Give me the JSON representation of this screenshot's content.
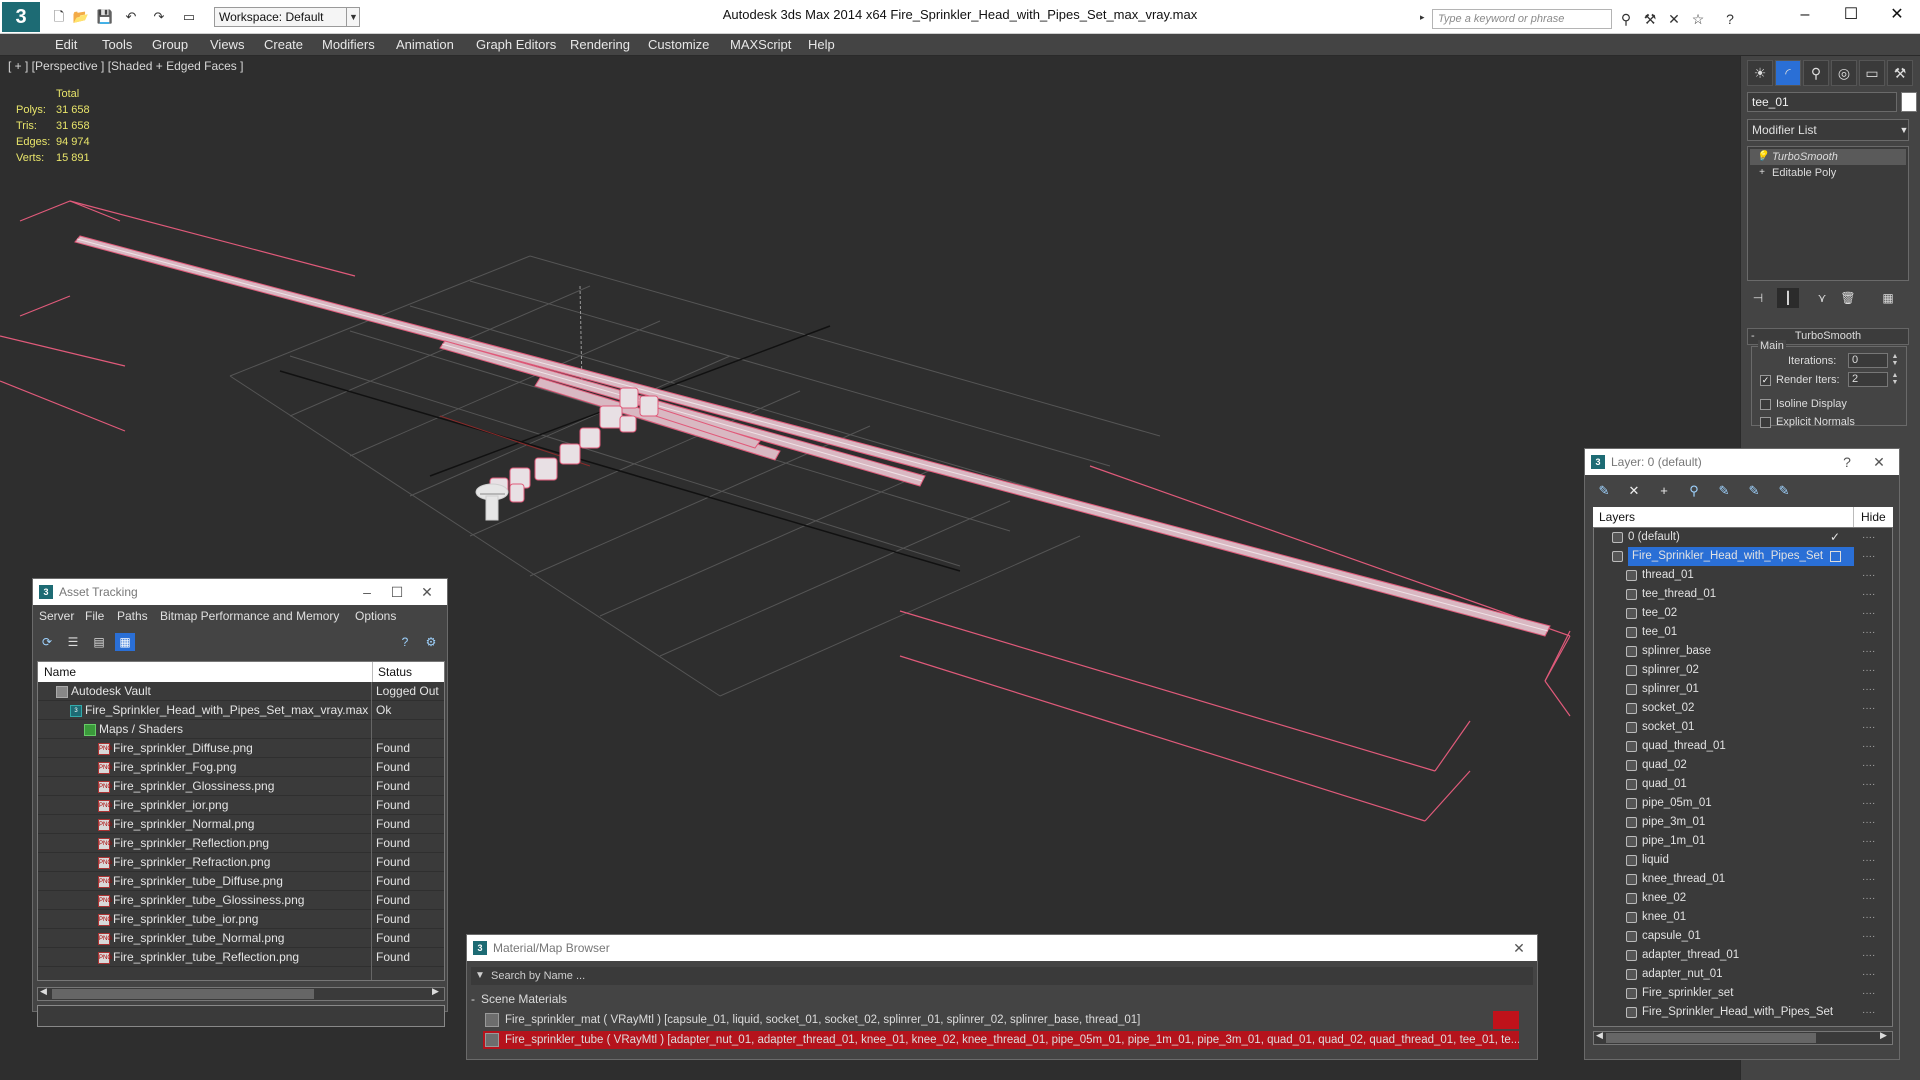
{
  "window": {
    "app_title": "Autodesk 3ds Max  2014 x64        Fire_Sprinkler_Head_with_Pipes_Set_max_vray.max",
    "workspace": "Workspace: Default",
    "search_placeholder": "Type a keyword or phrase",
    "minimize": "–",
    "maximize": "☐",
    "close": "✕"
  },
  "menu": [
    "Edit",
    "Tools",
    "Group",
    "Views",
    "Create",
    "Modifiers",
    "Animation",
    "Graph Editors",
    "Rendering",
    "Customize",
    "MAXScript",
    "Help"
  ],
  "viewport": {
    "label": "[ + ] [Perspective ] [Shaded + Edged Faces ]",
    "stats_header": "Total",
    "stats": [
      {
        "label": "Polys:",
        "value": "31 658"
      },
      {
        "label": "Tris:",
        "value": "31 658"
      },
      {
        "label": "Edges:",
        "value": "94 974"
      },
      {
        "label": "Verts:",
        "value": "15 891"
      }
    ]
  },
  "command_panel": {
    "object_name": "tee_01",
    "modifier_list": "Modifier List",
    "stack": [
      {
        "label": "TurboSmooth",
        "italic": true
      },
      {
        "label": "Editable Poly",
        "italic": false
      }
    ],
    "rollout_title": "TurboSmooth",
    "group_main": "Main",
    "iterations_label": "Iterations:",
    "iterations_value": "0",
    "render_iters_label": "Render Iters:",
    "render_iters_value": "2",
    "isoline_label": "Isoline Display",
    "explicit_label": "Explicit Normals"
  },
  "asset_tracking": {
    "title": "Asset Tracking",
    "menu": [
      "Server",
      "File",
      "Paths",
      "Bitmap Performance and Memory",
      "Options"
    ],
    "col_name": "Name",
    "col_status": "Status",
    "rows": [
      {
        "name": "Autodesk Vault",
        "status": "Logged Out",
        "indent": 1,
        "icon": "vault"
      },
      {
        "name": "Fire_Sprinkler_Head_with_Pipes_Set_max_vray.max",
        "status": "Ok",
        "indent": 2,
        "icon": "max"
      },
      {
        "name": "Maps / Shaders",
        "status": "",
        "indent": 3,
        "icon": "maps"
      },
      {
        "name": "Fire_sprinkler_Diffuse.png",
        "status": "Found",
        "indent": 4,
        "icon": "png"
      },
      {
        "name": "Fire_sprinkler_Fog.png",
        "status": "Found",
        "indent": 4,
        "icon": "png"
      },
      {
        "name": "Fire_sprinkler_Glossiness.png",
        "status": "Found",
        "indent": 4,
        "icon": "png"
      },
      {
        "name": "Fire_sprinkler_ior.png",
        "status": "Found",
        "indent": 4,
        "icon": "png"
      },
      {
        "name": "Fire_sprinkler_Normal.png",
        "status": "Found",
        "indent": 4,
        "icon": "png"
      },
      {
        "name": "Fire_sprinkler_Reflection.png",
        "status": "Found",
        "indent": 4,
        "icon": "png"
      },
      {
        "name": "Fire_sprinkler_Refraction.png",
        "status": "Found",
        "indent": 4,
        "icon": "png"
      },
      {
        "name": "Fire_sprinkler_tube_Diffuse.png",
        "status": "Found",
        "indent": 4,
        "icon": "png"
      },
      {
        "name": "Fire_sprinkler_tube_Glossiness.png",
        "status": "Found",
        "indent": 4,
        "icon": "png"
      },
      {
        "name": "Fire_sprinkler_tube_ior.png",
        "status": "Found",
        "indent": 4,
        "icon": "png"
      },
      {
        "name": "Fire_sprinkler_tube_Normal.png",
        "status": "Found",
        "indent": 4,
        "icon": "png"
      },
      {
        "name": "Fire_sprinkler_tube_Reflection.png",
        "status": "Found",
        "indent": 4,
        "icon": "png"
      }
    ]
  },
  "material_browser": {
    "title": "Material/Map Browser",
    "search_placeholder": "Search by Name ...",
    "section": "Scene Materials",
    "materials": [
      "Fire_sprinkler_mat  ( VRayMtl ) [capsule_01, liquid, socket_01, socket_02, splinrer_01, splinrer_02, splinrer_base, thread_01]",
      "Fire_sprinkler_tube  ( VRayMtl ) [adapter_nut_01, adapter_thread_01, knee_01, knee_02, knee_thread_01, pipe_05m_01, pipe_1m_01, pipe_3m_01, quad_01, quad_02, quad_thread_01, tee_01, te..."
    ]
  },
  "layers": {
    "title": "Layer: 0 (default)",
    "help": "?",
    "col_layers": "Layers",
    "col_hide": "Hide",
    "rows": [
      {
        "name": "0 (default)",
        "type": "layer",
        "selected": false
      },
      {
        "name": "Fire_Sprinkler_Head_with_Pipes_Set",
        "type": "layer",
        "selected": true
      },
      {
        "name": "thread_01",
        "type": "object",
        "selected": false
      },
      {
        "name": "tee_thread_01",
        "type": "object",
        "selected": false
      },
      {
        "name": "tee_02",
        "type": "object",
        "selected": false
      },
      {
        "name": "tee_01",
        "type": "object",
        "selected": false
      },
      {
        "name": "splinrer_base",
        "type": "object",
        "selected": false
      },
      {
        "name": "splinrer_02",
        "type": "object",
        "selected": false
      },
      {
        "name": "splinrer_01",
        "type": "object",
        "selected": false
      },
      {
        "name": "socket_02",
        "type": "object",
        "selected": false
      },
      {
        "name": "socket_01",
        "type": "object",
        "selected": false
      },
      {
        "name": "quad_thread_01",
        "type": "object",
        "selected": false
      },
      {
        "name": "quad_02",
        "type": "object",
        "selected": false
      },
      {
        "name": "quad_01",
        "type": "object",
        "selected": false
      },
      {
        "name": "pipe_05m_01",
        "type": "object",
        "selected": false
      },
      {
        "name": "pipe_3m_01",
        "type": "object",
        "selected": false
      },
      {
        "name": "pipe_1m_01",
        "type": "object",
        "selected": false
      },
      {
        "name": "liquid",
        "type": "object",
        "selected": false
      },
      {
        "name": "knee_thread_01",
        "type": "object",
        "selected": false
      },
      {
        "name": "knee_02",
        "type": "object",
        "selected": false
      },
      {
        "name": "knee_01",
        "type": "object",
        "selected": false
      },
      {
        "name": "capsule_01",
        "type": "object",
        "selected": false
      },
      {
        "name": "adapter_thread_01",
        "type": "object",
        "selected": false
      },
      {
        "name": "adapter_nut_01",
        "type": "object",
        "selected": false
      },
      {
        "name": "Fire_sprinkler_set",
        "type": "object",
        "selected": false
      },
      {
        "name": "Fire_Sprinkler_Head_with_Pipes_Set",
        "type": "object",
        "selected": false
      }
    ]
  },
  "colors": {
    "wire": "#e05a7a",
    "selection": "#2a6fd6",
    "stat_text": "#e8e46a",
    "bg": "#2e2e2e"
  }
}
